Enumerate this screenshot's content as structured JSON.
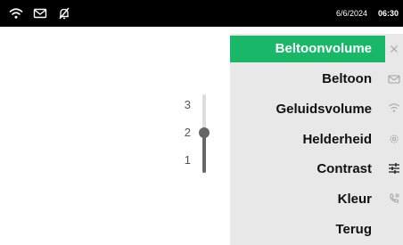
{
  "status_bar": {
    "icons": [
      "wifi-icon",
      "envelope-icon",
      "bell-muted-icon"
    ],
    "date": "6/6/2024",
    "time": "06:30",
    "background": "#000000",
    "text_color": "#ffffff"
  },
  "slider": {
    "levels": [
      "3",
      "2",
      "1"
    ],
    "value": 2,
    "min": 1,
    "max": 3,
    "fill_color": "#666666",
    "track_color": "#dddddd"
  },
  "menu": {
    "items": [
      {
        "label": "Beltoonvolume",
        "selected": true
      },
      {
        "label": "Beltoon",
        "selected": false
      },
      {
        "label": "Geluidsvolume",
        "selected": false
      },
      {
        "label": "Helderheid",
        "selected": false
      },
      {
        "label": "Contrast",
        "selected": false
      },
      {
        "label": "Kleur",
        "selected": false
      },
      {
        "label": "Terug",
        "selected": false
      }
    ],
    "selected_color": "#19b868",
    "background": "#e8e8e8"
  },
  "icon_bar": {
    "icons": [
      "close-icon",
      "envelope-icon",
      "wifi-icon",
      "gear-icon",
      "sliders-icon",
      "phone-settings-icon"
    ],
    "active_icon": "sliders-icon"
  }
}
